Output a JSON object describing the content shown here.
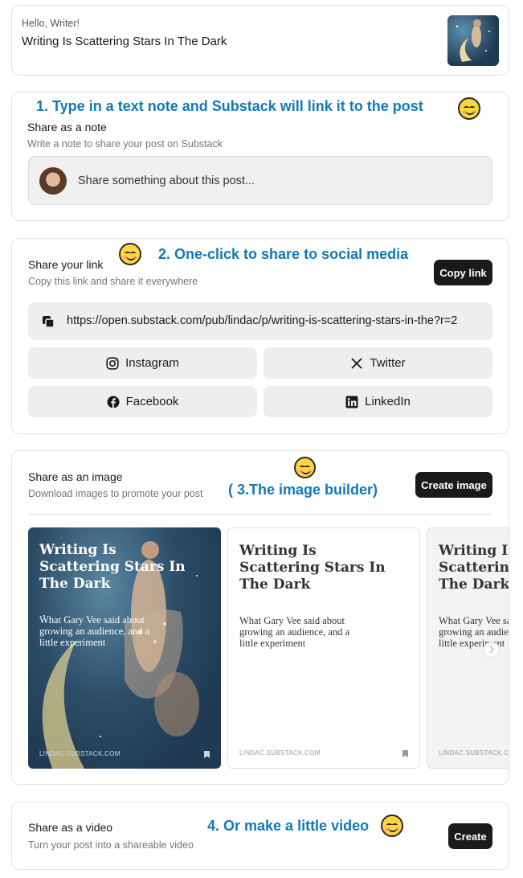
{
  "header": {
    "greeting": "Hello, Writer!",
    "post_title": "Writing Is Scattering Stars In The Dark"
  },
  "note": {
    "annotation": "1.  Type in a text note and Substack will link it to the post",
    "label": "Share as a note",
    "description": "Write a note to share your post on Substack",
    "placeholder": "Share something about this post..."
  },
  "link": {
    "annotation": "2. One-click to share to social media",
    "label": "Share your link",
    "description": "Copy this link and share it everywhere",
    "copy_button": "Copy link",
    "url": "https://open.substack.com/pub/lindac/p/writing-is-scattering-stars-in-the?r=2",
    "socials": [
      "Instagram",
      "Twitter",
      "Facebook",
      "LinkedIn"
    ]
  },
  "image": {
    "annotation": "( 3.The image builder)",
    "label": "Share as an image",
    "description": "Download images to promote your post",
    "create_button": "Create image",
    "cards": [
      {
        "title": "Writing Is Scattering Stars In The Dark",
        "subtitle": "What Gary Vee said about growing an audience, and a little experiment",
        "footer": "LINDAC.SUBSTACK.COM"
      },
      {
        "title": "Writing Is Scattering Stars In The Dark",
        "subtitle": "What Gary Vee said about growing an audience, and a little experiment",
        "footer": "LINDAC.SUBSTACK.COM"
      },
      {
        "title": "Writing Is Scattering Stars In The Dark",
        "subtitle": "What Gary Vee said about growing an audience, and a little experiment",
        "footer": "LINDAC.SUBSTACK.COM"
      }
    ]
  },
  "video": {
    "annotation": "4. Or make a little video",
    "label": "Share as a video",
    "description": "Turn your post into a shareable video",
    "create_button": "Create"
  },
  "colors": {
    "annotation": "#1179b8",
    "dark_button": "#1a1a1a",
    "pill_bg": "#eeeeee",
    "card_border": "#e3e3e3",
    "night_sky": "#1f3a52"
  },
  "icons": [
    "smiley-emoji-icon",
    "copy-icon",
    "instagram-icon",
    "x-twitter-icon",
    "facebook-icon",
    "linkedin-icon",
    "bookmark-icon",
    "chevron-right-icon"
  ]
}
